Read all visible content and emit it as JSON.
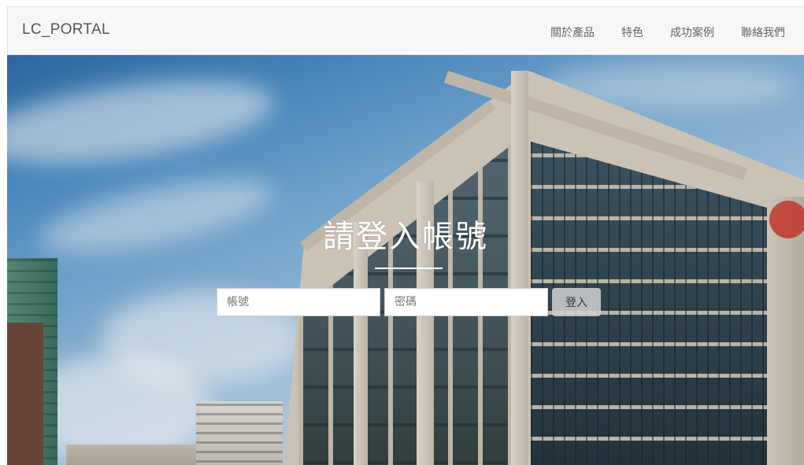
{
  "navbar": {
    "brand": "LC_PORTAL",
    "links": [
      {
        "label": "關於產品"
      },
      {
        "label": "特色"
      },
      {
        "label": "成功案例"
      },
      {
        "label": "聯絡我們"
      }
    ]
  },
  "hero": {
    "title": "請登入帳號",
    "username_placeholder": "帳號",
    "password_placeholder": "密碼",
    "login_label": "登入"
  }
}
